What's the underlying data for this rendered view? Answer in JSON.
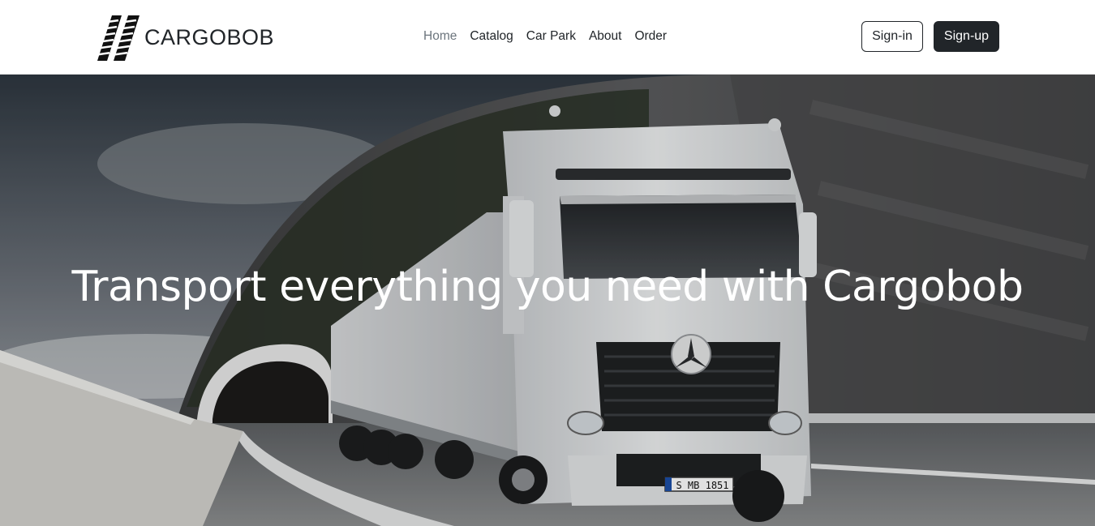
{
  "brand": {
    "name": "CARGOBOB",
    "logo_icon": "tire-tracks-icon"
  },
  "nav": {
    "items": [
      {
        "label": "Home",
        "active": true
      },
      {
        "label": "Catalog",
        "active": false
      },
      {
        "label": "Car Park",
        "active": false
      },
      {
        "label": "About",
        "active": false
      },
      {
        "label": "Order",
        "active": false
      }
    ]
  },
  "auth": {
    "signin_label": "Sign-in",
    "signup_label": "Sign-up"
  },
  "hero": {
    "title": "Transport everything you need with Cargobob",
    "plate": "S MB 1851"
  },
  "colors": {
    "dark": "#212529",
    "muted": "#6c757d",
    "white": "#ffffff"
  }
}
